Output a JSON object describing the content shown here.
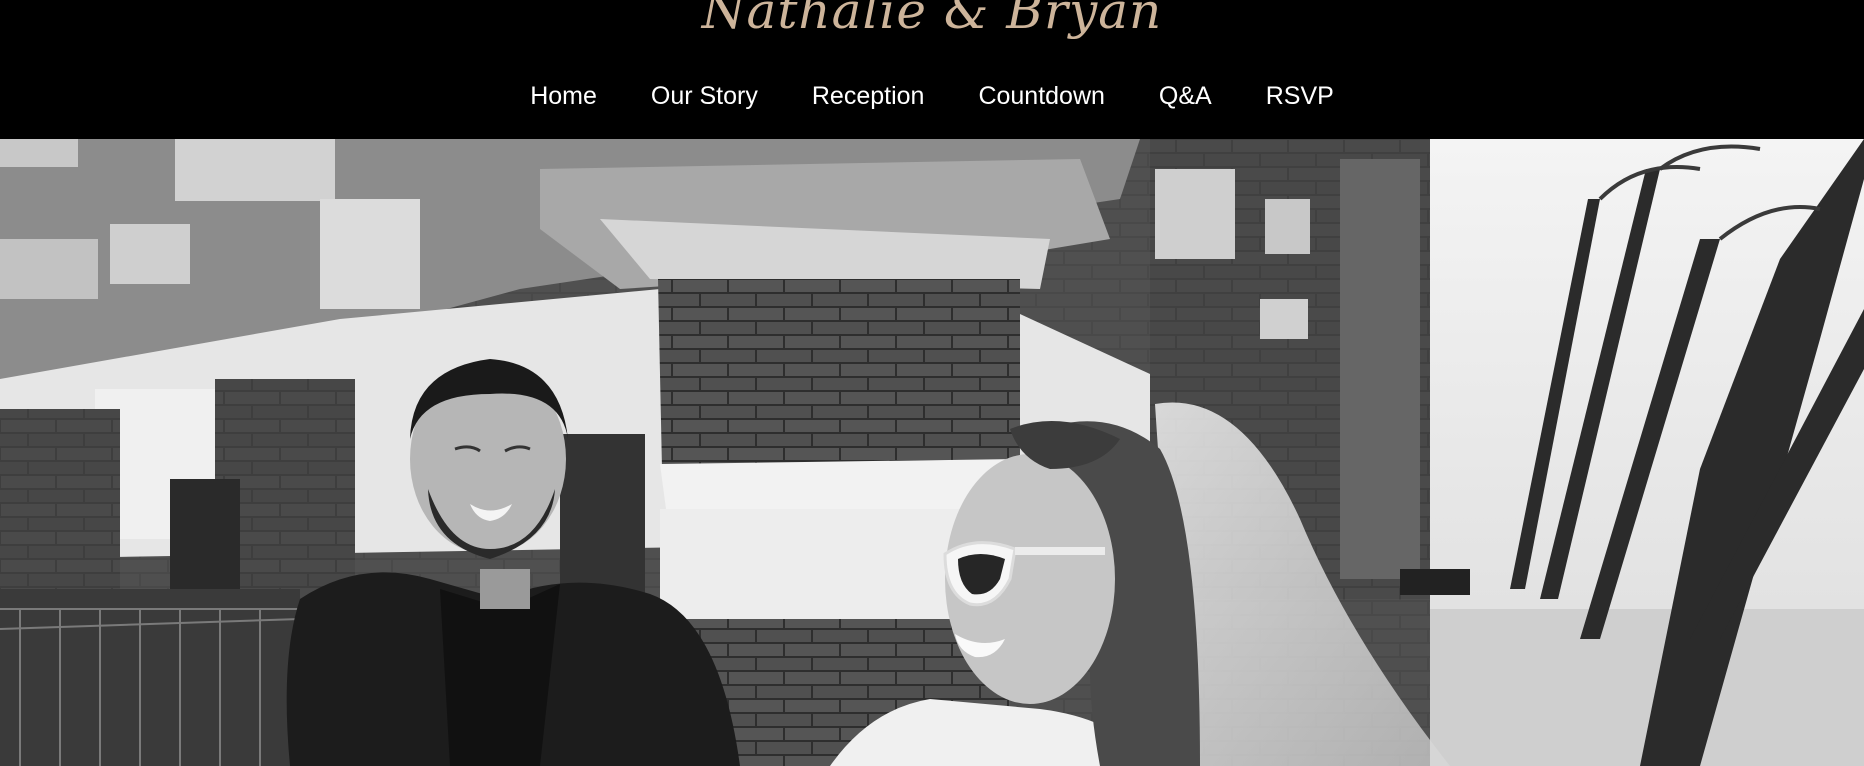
{
  "header": {
    "title": "Nathalie & Bryan",
    "nav": [
      {
        "label": "Home"
      },
      {
        "label": "Our Story"
      },
      {
        "label": "Reception"
      },
      {
        "label": "Countdown"
      },
      {
        "label": "Q&A"
      },
      {
        "label": "RSVP"
      }
    ]
  },
  "colors": {
    "header_bg": "#000000",
    "title": "#cdb49a",
    "nav_text": "#ffffff"
  }
}
